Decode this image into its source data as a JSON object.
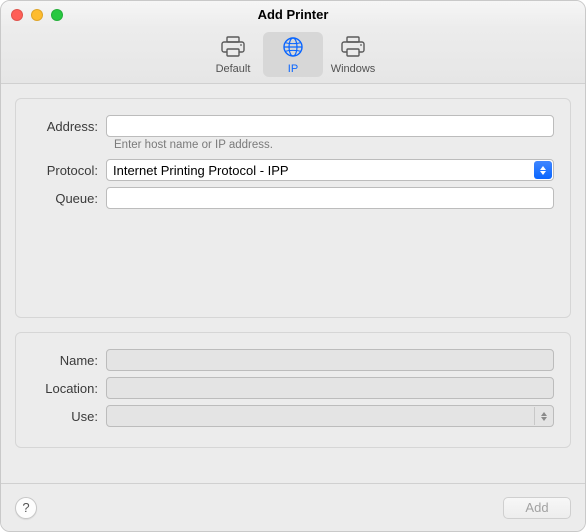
{
  "window": {
    "title": "Add Printer"
  },
  "tabs": {
    "default": {
      "label": "Default"
    },
    "ip": {
      "label": "IP"
    },
    "windows": {
      "label": "Windows"
    },
    "selected": "ip"
  },
  "form_top": {
    "address": {
      "label": "Address:",
      "value": "",
      "hint": "Enter host name or IP address."
    },
    "protocol": {
      "label": "Protocol:",
      "value": "Internet Printing Protocol - IPP"
    },
    "queue": {
      "label": "Queue:",
      "value": ""
    }
  },
  "form_bottom": {
    "name": {
      "label": "Name:",
      "value": ""
    },
    "location": {
      "label": "Location:",
      "value": ""
    },
    "use": {
      "label": "Use:",
      "value": ""
    }
  },
  "footer": {
    "help_label": "?",
    "add_label": "Add",
    "add_enabled": false
  },
  "icons": {
    "default": "printer-icon",
    "ip": "globe-icon",
    "windows": "printer-icon"
  }
}
